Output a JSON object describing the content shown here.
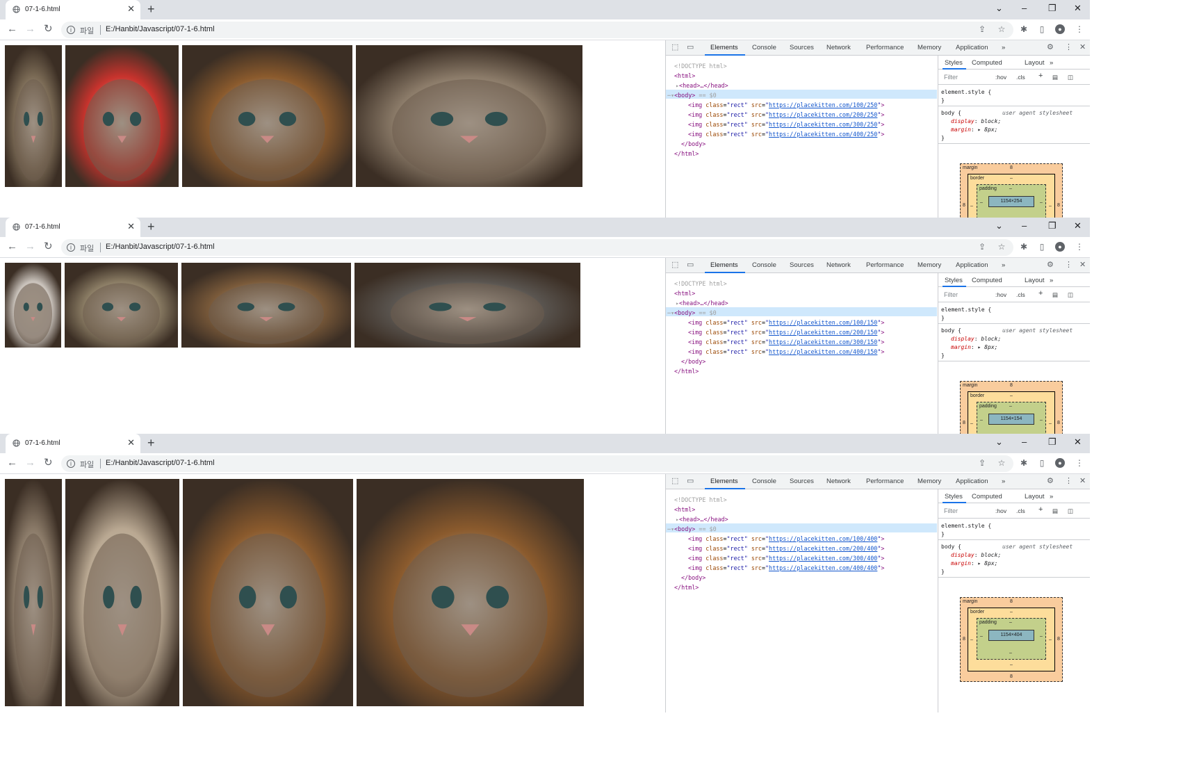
{
  "windows": [
    {
      "tab_title": "07-1-6.html",
      "url_scheme": "파일",
      "url": "E:/Hanbit/Javascript/07-1-6.html",
      "image_height": 250,
      "kitten_colors": [
        "#7a6a55",
        "#c8332d",
        "#8a5a2d",
        "#8a7a68"
      ],
      "box_content": "1154×254",
      "elements": {
        "doctype": "<!DOCTYPE html>",
        "html_open": "<html>",
        "head": "<head>…</head>",
        "body_open": "<body>",
        "body_marker": "== $0",
        "srcs": [
          "https://placekitten.com/100/250",
          "https://placekitten.com/200/250",
          "https://placekitten.com/300/250",
          "https://placekitten.com/400/250"
        ],
        "body_close": "</body>",
        "html_close": "</html>"
      }
    },
    {
      "tab_title": "07-1-6.html",
      "url_scheme": "파일",
      "url": "E:/Hanbit/Javascript/07-1-6.html",
      "image_height": 150,
      "kitten_colors": [
        "#c9c2bb",
        "#8a7c64",
        "#7a5a3a",
        "#5a5550"
      ],
      "box_content": "1154×154",
      "elements": {
        "doctype": "<!DOCTYPE html>",
        "html_open": "<html>",
        "head": "<head>…</head>",
        "body_open": "<body>",
        "body_marker": "== $0",
        "srcs": [
          "https://placekitten.com/100/150",
          "https://placekitten.com/200/150",
          "https://placekitten.com/300/150",
          "https://placekitten.com/400/150"
        ],
        "body_close": "</body>",
        "html_close": "</html>"
      }
    },
    {
      "tab_title": "07-1-6.html",
      "url_scheme": "파일",
      "url": "E:/Hanbit/Javascript/07-1-6.html",
      "image_height": 400,
      "kitten_colors": [
        "#8a7a68",
        "#b9a892",
        "#8a5a2d",
        "#8a5a2d"
      ],
      "box_content": "1154×404",
      "elements": {
        "doctype": "<!DOCTYPE html>",
        "html_open": "<html>",
        "head": "<head>…</head>",
        "body_open": "<body>",
        "body_marker": "== $0",
        "srcs": [
          "https://placekitten.com/100/400",
          "https://placekitten.com/200/400",
          "https://placekitten.com/300/400",
          "https://placekitten.com/400/400"
        ],
        "body_close": "</body>",
        "html_close": "</html>"
      }
    }
  ],
  "devtools": {
    "tabs": [
      "Elements",
      "Console",
      "Sources",
      "Network",
      "Performance",
      "Memory",
      "Application"
    ],
    "more": "»",
    "style_tabs": [
      "Styles",
      "Computed",
      "Layout"
    ],
    "filter_placeholder": "Filter",
    "hov": ":hov",
    "cls": ".cls",
    "plus": "+",
    "img_tag": "img",
    "class_attr": "class",
    "class_val": "rect",
    "src_attr": "src",
    "element_style": "element.style {",
    "close_brace": "}",
    "body_rule": "body {",
    "ua_label": "user agent stylesheet",
    "prop_display": "display",
    "val_display": "block;",
    "prop_margin": "margin",
    "val_margin": "▸ 8px;",
    "bm_margin": "margin",
    "bm_margin_val": "8",
    "bm_border": "border",
    "bm_padding": "padding",
    "bm_dash": "–"
  },
  "icons": [
    "globe-icon",
    "close-icon",
    "new-tab-icon",
    "back-icon",
    "forward-icon",
    "reload-icon",
    "info-icon",
    "share-icon",
    "star-icon",
    "extensions-icon",
    "sidepanel-icon",
    "profile-icon",
    "menu-icon",
    "minimize-icon",
    "restore-icon",
    "window-close-icon",
    "chevron-down-icon",
    "inspect-icon",
    "device-icon",
    "gear-icon",
    "kebab-icon"
  ]
}
